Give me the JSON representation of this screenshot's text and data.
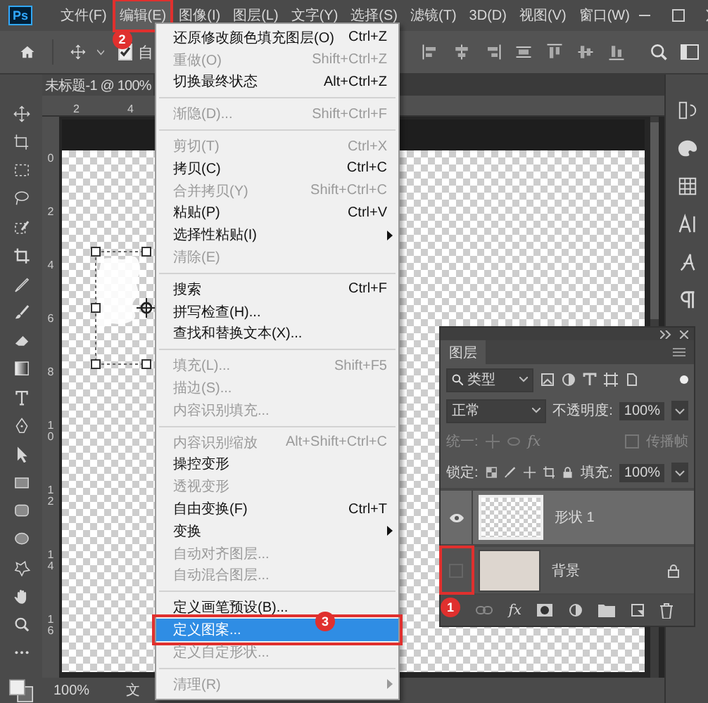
{
  "menubar": {
    "logo": "Ps",
    "items": [
      {
        "label": "文件(F)",
        "selected": false
      },
      {
        "label": "编辑(E)",
        "selected": true,
        "callout": "2"
      },
      {
        "label": "图像(I)",
        "selected": false
      },
      {
        "label": "图层(L)",
        "selected": false
      },
      {
        "label": "文字(Y)",
        "selected": false
      },
      {
        "label": "选择(S)",
        "selected": false
      },
      {
        "label": "滤镜(T)",
        "selected": false
      },
      {
        "label": "3D(D)",
        "selected": false
      },
      {
        "label": "视图(V)",
        "selected": false
      },
      {
        "label": "窗口(W)",
        "selected": false
      }
    ]
  },
  "options_bar": {
    "auto_select": {
      "label": "自",
      "checked": true
    }
  },
  "document_tab": {
    "title": "未标题-1 @ 100%"
  },
  "rulers": {
    "horizontal": [
      "2",
      "4"
    ],
    "vertical": [
      "0",
      "2",
      "4",
      "6",
      "8",
      "10",
      "12",
      "14",
      "16"
    ]
  },
  "edit_menu": {
    "items": [
      {
        "kind": "item",
        "label": "还原修改颜色填充图层(O)",
        "shortcut": "Ctrl+Z",
        "disabled": false,
        "selected": false,
        "submenu": false
      },
      {
        "kind": "item",
        "label": "重做(O)",
        "shortcut": "Shift+Ctrl+Z",
        "disabled": true,
        "selected": false,
        "submenu": false
      },
      {
        "kind": "item",
        "label": "切换最终状态",
        "shortcut": "Alt+Ctrl+Z",
        "disabled": false,
        "selected": false,
        "submenu": false
      },
      {
        "kind": "separator"
      },
      {
        "kind": "item",
        "label": "渐隐(D)...",
        "shortcut": "Shift+Ctrl+F",
        "disabled": true,
        "selected": false,
        "submenu": false
      },
      {
        "kind": "separator"
      },
      {
        "kind": "item",
        "label": "剪切(T)",
        "shortcut": "Ctrl+X",
        "disabled": true,
        "selected": false,
        "submenu": false
      },
      {
        "kind": "item",
        "label": "拷贝(C)",
        "shortcut": "Ctrl+C",
        "disabled": false,
        "selected": false,
        "submenu": false
      },
      {
        "kind": "item",
        "label": "合并拷贝(Y)",
        "shortcut": "Shift+Ctrl+C",
        "disabled": true,
        "selected": false,
        "submenu": false
      },
      {
        "kind": "item",
        "label": "粘贴(P)",
        "shortcut": "Ctrl+V",
        "disabled": false,
        "selected": false,
        "submenu": false
      },
      {
        "kind": "item",
        "label": "选择性粘贴(I)",
        "disabled": false,
        "selected": false,
        "submenu": true
      },
      {
        "kind": "item",
        "label": "清除(E)",
        "disabled": true,
        "selected": false,
        "submenu": false
      },
      {
        "kind": "separator"
      },
      {
        "kind": "item",
        "label": "搜索",
        "shortcut": "Ctrl+F",
        "disabled": false,
        "selected": false,
        "submenu": false
      },
      {
        "kind": "item",
        "label": "拼写检查(H)...",
        "disabled": false,
        "selected": false,
        "submenu": false
      },
      {
        "kind": "item",
        "label": "查找和替换文本(X)...",
        "disabled": false,
        "selected": false,
        "submenu": false
      },
      {
        "kind": "separator"
      },
      {
        "kind": "item",
        "label": "填充(L)...",
        "shortcut": "Shift+F5",
        "disabled": true,
        "selected": false,
        "submenu": false
      },
      {
        "kind": "item",
        "label": "描边(S)...",
        "disabled": true,
        "selected": false,
        "submenu": false
      },
      {
        "kind": "item",
        "label": "内容识别填充...",
        "disabled": true,
        "selected": false,
        "submenu": false
      },
      {
        "kind": "separator"
      },
      {
        "kind": "item",
        "label": "内容识别缩放",
        "shortcut": "Alt+Shift+Ctrl+C",
        "disabled": true,
        "selected": false,
        "submenu": false
      },
      {
        "kind": "item",
        "label": "操控变形",
        "disabled": false,
        "selected": false,
        "submenu": false
      },
      {
        "kind": "item",
        "label": "透视变形",
        "disabled": true,
        "selected": false,
        "submenu": false
      },
      {
        "kind": "item",
        "label": "自由变换(F)",
        "shortcut": "Ctrl+T",
        "disabled": false,
        "selected": false,
        "submenu": false
      },
      {
        "kind": "item",
        "label": "变换",
        "disabled": false,
        "selected": false,
        "submenu": true
      },
      {
        "kind": "item",
        "label": "自动对齐图层...",
        "disabled": true,
        "selected": false,
        "submenu": false
      },
      {
        "kind": "item",
        "label": "自动混合图层...",
        "disabled": true,
        "selected": false,
        "submenu": false
      },
      {
        "kind": "separator"
      },
      {
        "kind": "item",
        "label": "定义画笔预设(B)...",
        "disabled": false,
        "selected": false,
        "submenu": false
      },
      {
        "kind": "item",
        "label": "定义图案...",
        "disabled": false,
        "selected": true,
        "submenu": false,
        "callout": "3"
      },
      {
        "kind": "item",
        "label": "定义自定形状...",
        "disabled": true,
        "selected": false,
        "submenu": false
      },
      {
        "kind": "separator"
      },
      {
        "kind": "item",
        "label": "清理(R)",
        "disabled": true,
        "selected": false,
        "submenu": true
      }
    ]
  },
  "layers_panel": {
    "title": "图层",
    "filter": "类型",
    "blend_mode": "正常",
    "opacity_label": "不透明度:",
    "opacity": "100%",
    "unify_label": "统一:",
    "unify_fx": "fx",
    "propagate_label": "传播帧",
    "propagate_checked": false,
    "lock_label": "锁定:",
    "fill_label": "填充:",
    "fill": "100%",
    "footer_fx": "fx",
    "layers": [
      {
        "name": "形状 1",
        "visible": true,
        "locked": false,
        "selected": true
      },
      {
        "name": "背景",
        "visible": false,
        "locked": true,
        "selected": false,
        "callout": "1"
      }
    ]
  },
  "status_bar": {
    "zoom": "100%",
    "document": "文"
  }
}
